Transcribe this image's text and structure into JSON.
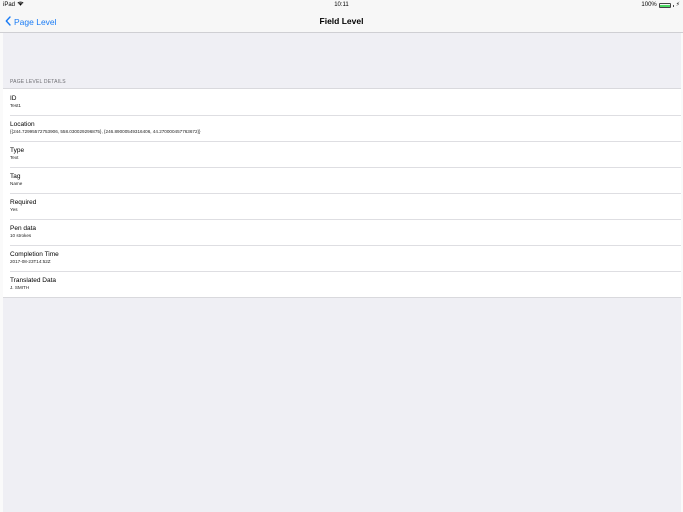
{
  "status_bar": {
    "device": "iPad",
    "time": "10:11",
    "battery": "100%"
  },
  "nav": {
    "back_label": "Page Level",
    "title": "Field Level"
  },
  "section": {
    "header": "PAGE LEVEL DETAILS"
  },
  "rows": [
    {
      "title": "ID",
      "value": "Test1"
    },
    {
      "title": "Location",
      "value": "{{244.72995572753906, 558.030029296875}, {246.89000549316406, 44.270000457763672}}"
    },
    {
      "title": "Type",
      "value": "Text"
    },
    {
      "title": "Tag",
      "value": "Name"
    },
    {
      "title": "Required",
      "value": "Yes"
    },
    {
      "title": "Pen data",
      "value": "10 strokes"
    },
    {
      "title": "Completion Time",
      "value": "2017-08-23T14:52Z"
    },
    {
      "title": "Translated Data",
      "value": "J. SMITH"
    }
  ],
  "colors": {
    "accent": "#1a7cf5",
    "background": "#efeff4",
    "battery": "#4cd964"
  }
}
